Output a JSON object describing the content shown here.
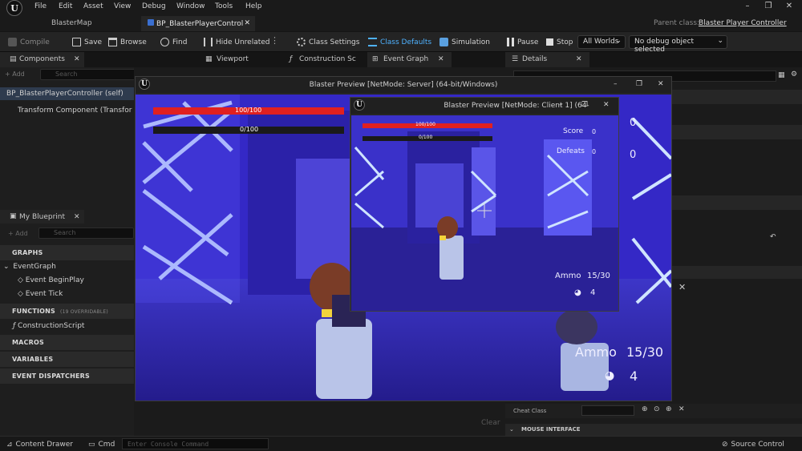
{
  "menubar": {
    "items": [
      "File",
      "Edit",
      "Asset",
      "View",
      "Debug",
      "Window",
      "Tools",
      "Help"
    ]
  },
  "doc_tabs": {
    "map": "BlasterMap",
    "blueprint": "BP_BlasterPlayerControl",
    "parent_class_label": "Parent class:",
    "parent_class_value": "Blaster Player Controller"
  },
  "toolbar": {
    "compile": "Compile",
    "save": "Save",
    "browse": "Browse",
    "find": "Find",
    "hide_unrelated": "Hide Unrelated",
    "class_settings": "Class Settings",
    "class_defaults": "Class Defaults",
    "simulation": "Simulation",
    "pause": "Pause",
    "stop": "Stop",
    "worlds": "All Worlds",
    "debug_object": "No debug object selected"
  },
  "panel_tabs": {
    "components": "Components",
    "viewport": "Viewport",
    "construction": "Construction Sc",
    "event_graph": "Event Graph",
    "details": "Details"
  },
  "components": {
    "add": "+ Add",
    "search": "Search",
    "items": [
      "BP_BlasterPlayerController (self)",
      "Transform Component (Transfor"
    ]
  },
  "my_blueprint": {
    "title": "My Blueprint",
    "add": "+ Add",
    "search": "Search",
    "graphs": "GRAPHS",
    "event_graph": "EventGraph",
    "begin_play": "Event BeginPlay",
    "tick": "Event Tick",
    "functions": "FUNCTIONS",
    "functions_note": "(19 OVERRIDABLE)",
    "construction": "ConstructionScript",
    "macros": "MACROS",
    "variables": "VARIABLES",
    "dispatchers": "EVENT DISPATCHERS"
  },
  "server_preview": {
    "title": "Blaster Preview [NetMode: Server]  (64-bit/Windows)",
    "health_text": "100/100",
    "shield_text": "0/100",
    "health_fraction": 1.0,
    "shield_fraction": 0.0,
    "score_value": "0",
    "defeats_value": "0",
    "ammo_label": "Ammo",
    "ammo_value": "15/30",
    "grenades": "4"
  },
  "client_preview": {
    "title": "Blaster Preview [NetMode: Client 1]  (64-",
    "health_text": "100/100",
    "shield_text": "0/100",
    "health_fraction": 1.0,
    "shield_fraction": 0.0,
    "score_label": "Score",
    "score_value": "0",
    "defeats_label": "Defeats",
    "defeats_value": "0",
    "ammo_label": "Ammo",
    "ammo_value": "15/30",
    "grenades": "4"
  },
  "details": {
    "cheat_class": "Cheat Class",
    "mouse_interface": "MOUSE INTERFACE",
    "clear": "Clear"
  },
  "statusbar": {
    "content_drawer": "Content Drawer",
    "cmd": "Cmd",
    "console_placeholder": "Enter Console Command",
    "source_control": "Source Control"
  },
  "colors": {
    "accent": "#2fa3ff",
    "health": "#e02020",
    "game_bg": "#3a2fd0",
    "neon": "#b8d8ff"
  }
}
